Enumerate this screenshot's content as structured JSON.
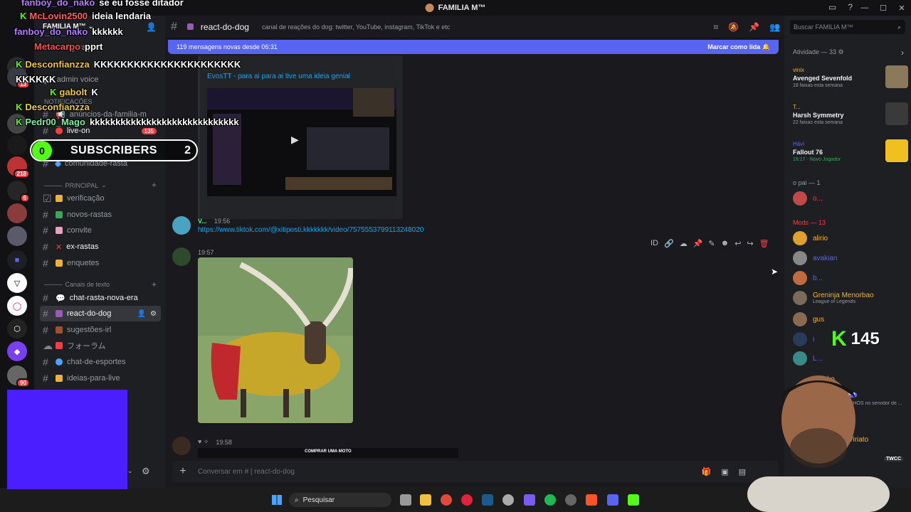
{
  "window": {
    "title": "FAMILIA M™"
  },
  "rail": {
    "badges": [
      "13",
      "218",
      "6",
      "90"
    ]
  },
  "sidebar": {
    "server_name": "FAMILIA M™",
    "config_item": "configurações",
    "admin_item": "admin voice",
    "cat_notificacoes": "NOTIFICAÇÕES",
    "channels_top": [
      {
        "label": "anúncios-da-familia-m"
      },
      {
        "label": "live-on",
        "count": "135"
      },
      {
        "label": "comunidade-rasta"
      }
    ],
    "cat_principal": "PRINCIPAL",
    "channels_principal": [
      "verificação",
      "novos-rastas",
      "convite",
      "ex-rastas",
      "enquetes"
    ],
    "cat_texto": "Canais de texto",
    "channels_texto": [
      "chat-rasta-nova-era",
      "react-do-dog",
      "sugestões-irl",
      "フォーラム",
      "chat-de-esportes",
      "ideias-para-live"
    ]
  },
  "header": {
    "channel": "react-do-dog",
    "topic": "canal de reações do dog: twitter, YouTube, instagram, TikTok e etc",
    "new_messages": "119 mensagens novas desde 06:31",
    "mark_read": "Marcar como lida"
  },
  "messages": {
    "embed_title": "EvosTT - para ai para ai tive uma ideia genial",
    "m1": {
      "author": "V...",
      "time": "19:56",
      "link": "https://www.tiktok.com/@xitiposti.kkkkkkk/video/7575553799113248020"
    },
    "m2": {
      "time": "19:57"
    },
    "m3": {
      "time": "19:58",
      "preview_text": "COMPRAR UMA MOTO"
    }
  },
  "composer": {
    "placeholder": "Conversar em # | react-do-dog"
  },
  "members": {
    "search_placeholder": "Buscar FAMILIA M™",
    "activity_header": "Atividade — 33",
    "activities": [
      {
        "user": "vinix",
        "game": "Avenged Sevenfold",
        "sub": "18 faixas esta semana"
      },
      {
        "user": "T...",
        "game": "Harsh Symmetry",
        "sub": "22 faixas esta semana"
      },
      {
        "user": "Hávi",
        "game": "Fallout 76",
        "sub": "18:17 · Novo Jogador"
      }
    ],
    "pai_header": "o pai — 1",
    "pai_member": "o...",
    "mods_header": "Mods — 13",
    "mods": [
      {
        "name": "alirio",
        "sub": "",
        "color": "#f0b232"
      },
      {
        "name": "avakian",
        "sub": "",
        "color": "#5865f2"
      },
      {
        "name": "b...",
        "sub": "",
        "color": "#5865f2"
      },
      {
        "name": "Greninja Menorbao",
        "sub": "League of Legends",
        "color": "#f0b232"
      },
      {
        "name": "gus",
        "sub": "",
        "color": "#f0b232"
      },
      {
        "name": "i",
        "sub": "",
        "color": "#5865f2"
      },
      {
        "name": "L...",
        "sub": "",
        "color": "#5865f2"
      }
    ],
    "partial_name1": "...ko",
    "app_badge": "APP",
    "partial_sub": "...ONHOS no servidor de ...",
    "partial_name2": "Viriato",
    "twcc": "TWCC"
  },
  "taskbar": {
    "search": "Pesquisar"
  },
  "overlay": {
    "chat": [
      {
        "user": "fanboy_do_nako",
        "text": "se eu fosse ditador",
        "color": "#b57bff",
        "kick": false
      },
      {
        "user": "McLovin2500",
        "text": "ideia lendaria",
        "color": "#ff5e5e",
        "kick": true
      },
      {
        "user": "fanboy_do_nako",
        "text": "kkkkkk",
        "color": "#b57bff",
        "kick": false
      },
      {
        "user": "Metacarpo",
        "text": "pprt",
        "color": "#ff4d4d",
        "kick": false
      },
      {
        "user": "Desconfianzza",
        "text": "KKKKKKKKKKKKKKKKKKKKKK KKKKKK",
        "color": "#f0c93a",
        "kick": true
      },
      {
        "user": "gabolt",
        "text": "K",
        "color": "#f0c93a",
        "kick": true
      },
      {
        "user": "Desconfianzza",
        "text": "",
        "color": "#f0c93a",
        "kick": true
      },
      {
        "user": "Pedr00_Mago",
        "text": "kkkkkkkkkkkkkkkkkkkkkkkkkkkkk",
        "color": "#7ef0a0",
        "kick": true
      }
    ],
    "subs_left": "0",
    "subs_label": "SUBSCRIBERS",
    "subs_right": "2",
    "viewers": "145"
  },
  "colors": {
    "accent": "#5865f2",
    "kick_green": "#53fc18",
    "danger": "#f23f43",
    "link": "#00a8fc"
  }
}
